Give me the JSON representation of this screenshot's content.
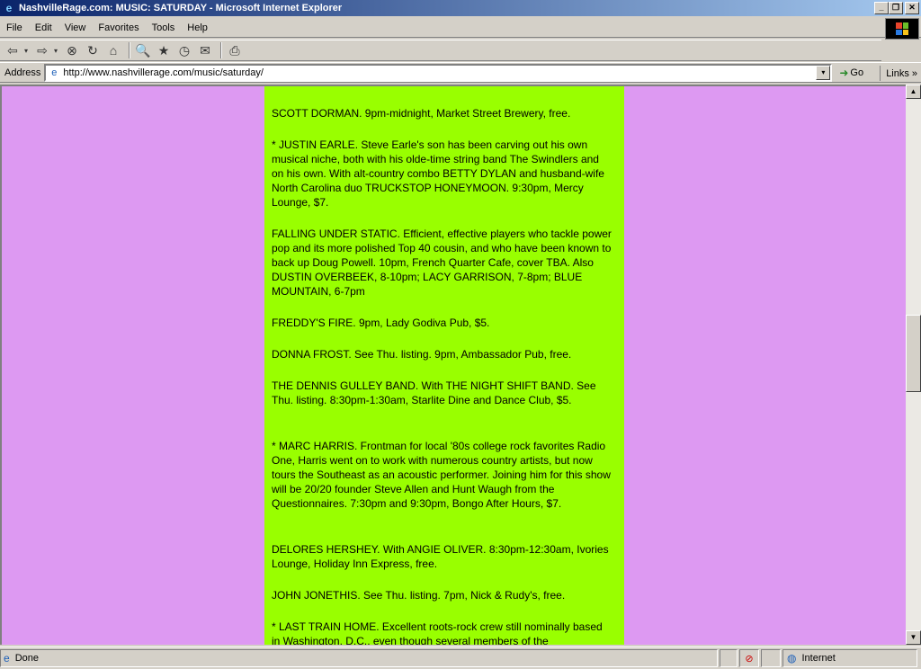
{
  "window": {
    "title": "NashvilleRage.com: MUSIC: SATURDAY - Microsoft Internet Explorer",
    "controls": {
      "minimize": "_",
      "restore": "❐",
      "close": "✕"
    }
  },
  "menu": {
    "items": [
      "File",
      "Edit",
      "View",
      "Favorites",
      "Tools",
      "Help"
    ]
  },
  "toolbar": {
    "back": "⇦",
    "forward": "⇨",
    "stop": "⊗",
    "refresh": "↻",
    "home": "⌂",
    "search": "🔍",
    "favorites": "★",
    "history": "◷",
    "mail": "✉",
    "print": "⎙",
    "dropdown": "▾"
  },
  "address": {
    "label": "Address",
    "url": "http://www.nashvillerage.com/music/saturday/",
    "go": "Go",
    "links": "Links",
    "links_chevron": "»"
  },
  "page": {
    "background_color": "#dd99f2",
    "column_color": "#99ff00",
    "listings": [
      "SCOTT DORMAN. 9pm-midnight, Market Street Brewery, free.",
      "* JUSTIN EARLE. Steve Earle's son has been carving out his own musical niche, both with his olde-time string band The Swindlers and on his own. With alt-country combo BETTY DYLAN and husband-wife North Carolina duo TRUCKSTOP HONEYMOON. 9:30pm, Mercy Lounge, $7.",
      "FALLING UNDER STATIC. Efficient, effective players who tackle power pop and its more polished Top 40 cousin, and who have been known to back up Doug Powell. 10pm, French Quarter Cafe, cover TBA. Also DUSTIN OVERBEEK, 8-10pm; LACY GARRISON, 7-8pm; BLUE MOUNTAIN, 6-7pm",
      "FREDDY'S FIRE. 9pm, Lady Godiva Pub, $5.",
      "DONNA FROST. See Thu. listing. 9pm, Ambassador Pub, free.",
      "THE DENNIS GULLEY BAND. With THE NIGHT SHIFT BAND. See Thu. listing. 8:30pm-1:30am, Starlite Dine and Dance Club, $5.",
      "* MARC HARRIS. Frontman for local '80s college rock favorites Radio One, Harris went on to work with numerous country artists, but now tours the Southeast as an acoustic performer. Joining him for this show will be 20/20 founder Steve Allen and Hunt Waugh from the Questionnaires. 7:30pm and 9:30pm, Bongo After Hours, $7.",
      "DELORES HERSHEY. With ANGIE OLIVER. 8:30pm-12:30am, Ivories Lounge, Holiday Inn Express, free.",
      "JOHN JONETHIS. See Thu. listing. 7pm, Nick & Rudy's, free.",
      "* LAST TRAIN HOME. Excellent roots-rock crew still nominally based in Washington, D.C., even though several members of the"
    ]
  },
  "status": {
    "text": "Done",
    "zone": "Internet"
  }
}
